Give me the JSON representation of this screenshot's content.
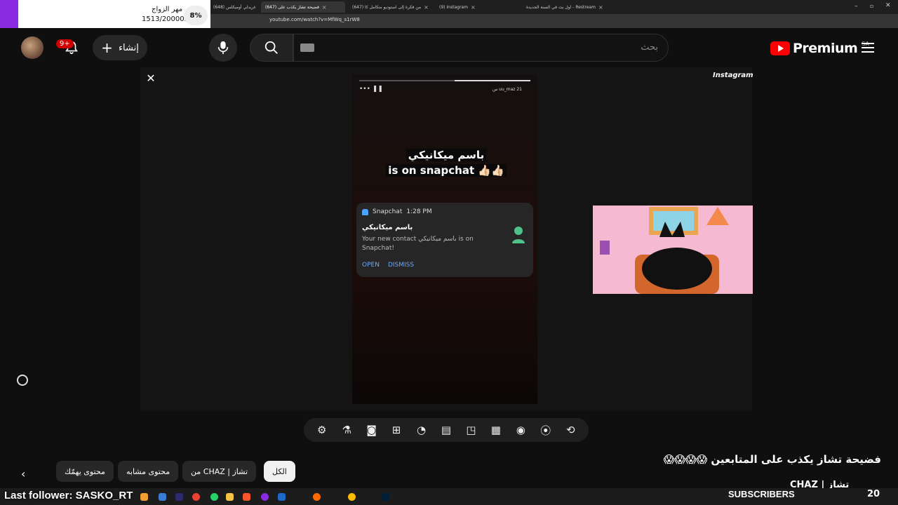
{
  "browser": {
    "tabs": [
      {
        "label": "(648) غريدلي أوميكلس",
        "active": false
      },
      {
        "label": "(647) فضيحة تشاز يكذب على",
        "active": true
      },
      {
        "label": "(647) من فكرة إلى استوديو متكامل كا",
        "active": false
      },
      {
        "label": "(9) Instagram",
        "active": false
      },
      {
        "label": "اول بث في السنة الجديدة - Restream",
        "active": false
      }
    ],
    "url": "youtube.com/watch?v=MfWq_s1rW8"
  },
  "goal_widget": {
    "title": "مهر الزواج",
    "value": "1513/20000$",
    "percent": "8%",
    "accent": "#8d2be2"
  },
  "header": {
    "logo_text": "Premium",
    "region": "SA",
    "search_placeholder": "بحث",
    "create_label": "إنشاء",
    "notif_count": "9+"
  },
  "player": {
    "watermark": "Instagram",
    "story_user": "uu_maz  21 س",
    "caption_line1": "باسم ميكانيكي",
    "caption_line2": "is on snapchat 👍🏻👍🏻",
    "notification": {
      "app": "Snapchat",
      "time": "1:28 PM",
      "title": "باسم ميكانيكي",
      "body": "Your new contact باسم ميكانيكي is on Snapchat!",
      "open": "OPEN",
      "dismiss": "DISMISS"
    }
  },
  "toolbar_icons": [
    "gear-icon",
    "flask-icon",
    "camera-icon",
    "ai-plus-icon",
    "speed-icon",
    "cinema-icon",
    "pip-icon",
    "clapper-icon",
    "view-icon",
    "broadcast-icon",
    "loop-icon"
  ],
  "video": {
    "title": "فضيحة تشاز يكذب على المتابعين 😱😱😱😱",
    "channel": "تشاز | CHAZ"
  },
  "chips": [
    "الكل",
    "من CHAZ | تشاز",
    "محتوى مشابه",
    "محتوى يهمّك"
  ],
  "stream_overlay": {
    "last_follower": "Last follower: SASKO_RT",
    "subscribers_label": "SUBSCRIBERS",
    "subscribers_count": "20"
  }
}
